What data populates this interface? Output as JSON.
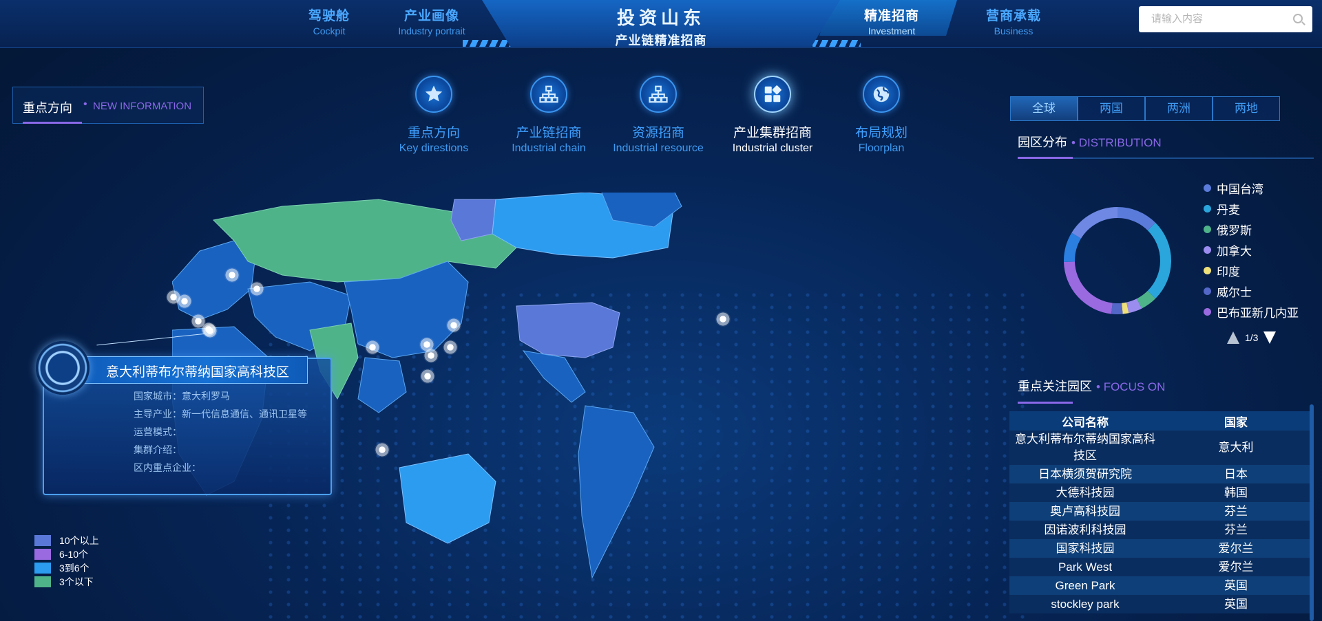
{
  "nav": {
    "items": [
      {
        "zh": "驾驶舱",
        "en": "Cockpit"
      },
      {
        "zh": "产业画像",
        "en": "Industry portrait"
      },
      {
        "zh": "精准招商",
        "en": "Investment"
      },
      {
        "zh": "营商承载",
        "en": "Business"
      }
    ],
    "active_index": 2,
    "title_main": "投资山东",
    "title_sub": "产业链精准招商",
    "search_placeholder": "请输入内容"
  },
  "left_panel": {
    "title_zh": "重点方向",
    "title_en": "NEW INFORMATION"
  },
  "menu": {
    "items": [
      {
        "zh": "重点方向",
        "en": "Key direstions",
        "icon": "star-icon"
      },
      {
        "zh": "产业链招商",
        "en": "Industrial chain",
        "icon": "hierarchy-icon"
      },
      {
        "zh": "资源招商",
        "en": "Industrial resource",
        "icon": "hierarchy-icon"
      },
      {
        "zh": "产业集群招商",
        "en": "Industrial cluster",
        "icon": "cluster-icon"
      },
      {
        "zh": "布局规划",
        "en": "Floorplan",
        "icon": "globe-icon"
      }
    ],
    "active_index": 3
  },
  "info_card": {
    "title": "意大利蒂布尔蒂纳国家高科技区",
    "rows": [
      "国家城市：意大利罗马",
      "主导产业：新一代信息通信、通讯卫星等",
      "运营模式：",
      "集群介绍：",
      "区内重点企业："
    ]
  },
  "map_legend": [
    {
      "label": "10个以上",
      "color": "#5a78d8"
    },
    {
      "label": "6-10个",
      "color": "#9a6ae0"
    },
    {
      "label": "3到6个",
      "color": "#2b9cf0"
    },
    {
      "label": "3个以下",
      "color": "#4fb38a"
    }
  ],
  "right_panel": {
    "tabs": [
      "全球",
      "两国",
      "两洲",
      "两地"
    ],
    "active_tab": 0,
    "distribution_title": "园区分布",
    "distribution_en": "DISTRIBUTION",
    "focus_title": "重点关注园区",
    "focus_en": "FOCUS ON",
    "pager": "1/3",
    "donut_legend": [
      {
        "label": "中国台湾",
        "color": "#5b7bdb"
      },
      {
        "label": "丹麦",
        "color": "#2ba6dc"
      },
      {
        "label": "俄罗斯",
        "color": "#4fb38a"
      },
      {
        "label": "加拿大",
        "color": "#9b8cf0"
      },
      {
        "label": "印度",
        "color": "#f0e07a"
      },
      {
        "label": "威尔士",
        "color": "#5367c8"
      },
      {
        "label": "巴布亚新几内亚",
        "color": "#9a6ae0"
      }
    ],
    "table": {
      "headers": [
        "公司名称",
        "国家"
      ],
      "rows": [
        [
          "意大利蒂布尔蒂纳国家高科技区",
          "意大利"
        ],
        [
          "日本横须贺研究院",
          "日本"
        ],
        [
          "大德科技园",
          "韩国"
        ],
        [
          "奥卢高科技园",
          "芬兰"
        ],
        [
          "因诺波利科技园",
          "芬兰"
        ],
        [
          "国家科技园",
          "爱尔兰"
        ],
        [
          "Park West",
          "爱尔兰"
        ],
        [
          "Green Park",
          "英国"
        ],
        [
          "stockley park",
          "英国"
        ]
      ]
    }
  }
}
